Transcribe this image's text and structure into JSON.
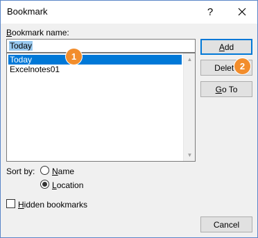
{
  "dialog": {
    "title": "Bookmark",
    "help_glyph": "?",
    "bookmark_name_label_hotkey": "B",
    "bookmark_name_label_rest": "ookmark name:",
    "name_value": "Today"
  },
  "bookmarks": {
    "items": [
      "Today",
      "Excelnotes01"
    ],
    "selected_index": 0
  },
  "buttons": {
    "add_hotkey": "A",
    "add_rest": "dd",
    "delete": "Delete",
    "goto_hotkey": "G",
    "goto_rest": "o To",
    "cancel": "Cancel"
  },
  "sort": {
    "label": "Sort by:",
    "name_hotkey": "N",
    "name_rest": "ame",
    "location_hotkey": "L",
    "location_rest": "ocation",
    "selected": "Location"
  },
  "hidden_bookmarks": {
    "hotkey": "H",
    "rest": "idden bookmarks",
    "checked": false
  },
  "callouts": [
    "1",
    "2"
  ],
  "colors": {
    "selection": "#0078d7",
    "callout": "#f28d2c",
    "default_button_border": "#0078d7"
  },
  "icons": [
    "close-icon",
    "scroll-up-arrow-icon",
    "scroll-down-arrow-icon"
  ]
}
